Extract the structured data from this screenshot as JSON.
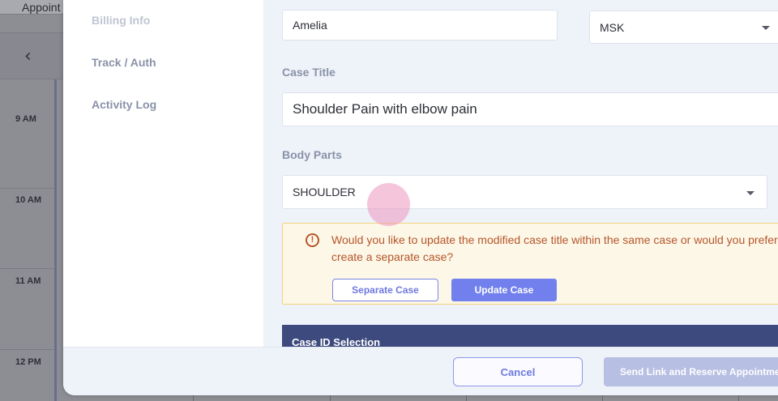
{
  "background": {
    "tab_label": "Appoint",
    "time_slots": [
      "9 AM",
      "10 AM",
      "11 AM",
      "12 PM"
    ]
  },
  "sidebar": {
    "items": [
      {
        "label": "Billing Info"
      },
      {
        "label": "Track / Auth"
      },
      {
        "label": "Activity Log"
      }
    ]
  },
  "form": {
    "first_name_value": "Amelia",
    "case_type_value": "MSK",
    "case_title_label": "Case Title",
    "case_title_value": "Shoulder Pain with elbow pain",
    "body_parts_label": "Body Parts",
    "body_parts_value": "SHOULDER"
  },
  "alert": {
    "message": "Would you like to update the modified case title within the same case or would you prefer to create a separate case?",
    "separate_label": "Separate Case",
    "update_label": "Update Case",
    "icon": "alert-circle-icon"
  },
  "case_id_section": {
    "title": "Case ID Selection"
  },
  "footer": {
    "cancel_label": "Cancel",
    "send_label": "Send Link and Reserve Appointment"
  },
  "colors": {
    "primary": "#7180ec",
    "alert_text": "#b5562a",
    "alert_bg": "#fdf7e8",
    "section_header": "#3d4a7e"
  }
}
